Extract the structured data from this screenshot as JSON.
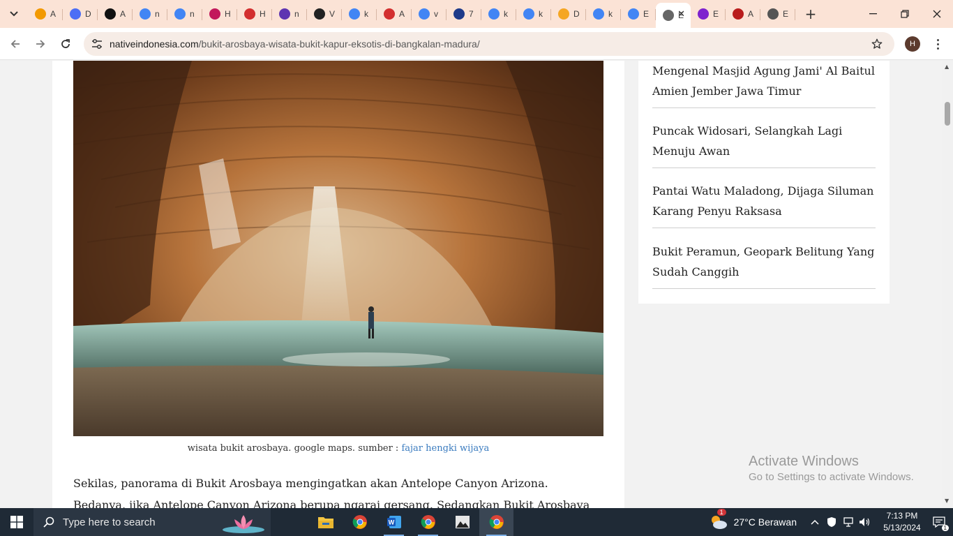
{
  "browser": {
    "tabs": [
      {
        "title": "A",
        "icon": "analytics-icon",
        "color": "#f29900"
      },
      {
        "title": "D",
        "icon": "docs-icon",
        "color": "#4c6ef5"
      },
      {
        "title": "A",
        "icon": "ro-icon",
        "color": "#111111"
      },
      {
        "title": "n",
        "icon": "google-icon",
        "color": "#4285f4"
      },
      {
        "title": "n",
        "icon": "google-icon",
        "color": "#4285f4"
      },
      {
        "title": "H",
        "icon": "detik-icon",
        "color": "#c2185b"
      },
      {
        "title": "H",
        "icon": "pinterest-icon",
        "color": "#d32f2f"
      },
      {
        "title": "n",
        "icon": "detik-icon",
        "color": "#5e35b1"
      },
      {
        "title": "V",
        "icon": "idn-icon",
        "color": "#222222"
      },
      {
        "title": "k",
        "icon": "google-icon",
        "color": "#4285f4"
      },
      {
        "title": "A",
        "icon": "pinterest-icon",
        "color": "#d32f2f"
      },
      {
        "title": "v",
        "icon": "google-icon",
        "color": "#4285f4"
      },
      {
        "title": "7",
        "icon": "flag-icon",
        "color": "#1e3a8a"
      },
      {
        "title": "k",
        "icon": "google-icon",
        "color": "#4285f4"
      },
      {
        "title": "k",
        "icon": "google-icon",
        "color": "#4285f4"
      },
      {
        "title": "D",
        "icon": "puzzle-icon",
        "color": "#f5a623"
      },
      {
        "title": "k",
        "icon": "google-icon",
        "color": "#4285f4"
      },
      {
        "title": "E",
        "icon": "google-icon",
        "color": "#4285f4"
      },
      {
        "title": "E",
        "icon": "native-icon",
        "color": "#666666",
        "active": true
      },
      {
        "title": "E",
        "icon": "m-icon",
        "color": "#7e22ce"
      },
      {
        "title": "A",
        "icon": "bookmark-red-icon",
        "color": "#b91c1c"
      },
      {
        "title": "E",
        "icon": "globe-icon",
        "color": "#555555"
      }
    ],
    "url_host": "nativeindonesia.com",
    "url_path": "/bukit-arosbaya-wisata-bukit-kapur-eksotis-di-bangkalan-madura/",
    "profile_initial": "H",
    "accent": "#fbe3d6"
  },
  "article": {
    "caption_text": "wisata bukit arosbaya. google maps. sumber : ",
    "caption_link": "fajar hengki wijaya",
    "paragraph": "Sekilas, panorama di Bukit Arosbaya mengingatkan akan Antelope Canyon Arizona. Bedanya, jika Antelope Canyon Arizona berupa ngarai gersang. Sedangkan Bukit Arosbaya ini ditumbuhi banyak"
  },
  "sidebar": {
    "items": [
      "Mengenal Masjid Agung Jami' Al Baitul Amien Jember Jawa Timur",
      "Puncak Widosari, Selangkah Lagi Menuju Awan",
      "Pantai Watu Maladong, Dijaga Siluman Karang Penyu Raksasa",
      "Bukit Peramun, Geopark Belitung Yang Sudah Canggih"
    ]
  },
  "watermark": {
    "line1": "Activate Windows",
    "line2": "Go to Settings to activate Windows."
  },
  "taskbar": {
    "search_placeholder": "Type here to search",
    "weather": "27°C  Berawan",
    "weather_badge": "1",
    "time": "7:13 PM",
    "date": "5/13/2024",
    "notification_count": "1"
  }
}
